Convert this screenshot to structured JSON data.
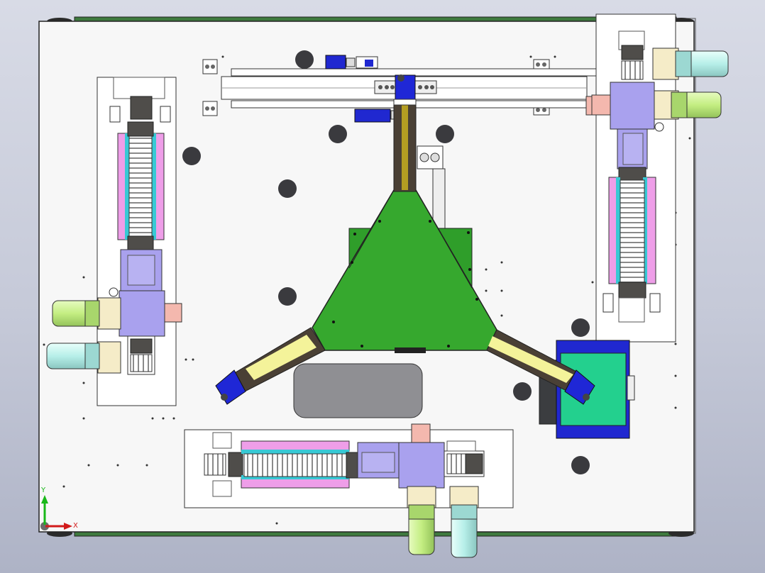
{
  "axis_triad": {
    "x_label": "X",
    "y_label": "Y"
  },
  "colors": {
    "background_top": "#d8dbe6",
    "background_bottom": "#aeb3c6",
    "base_plate": "#f7f7f7",
    "frame_edge": "#3e7a3e",
    "rail": "#9a9ab8",
    "carriage": "#a9a1ee",
    "linear_guide": "#ee9ee8",
    "guide_inner": "#37c9d5",
    "motor_green": "#c8f08a",
    "motor_cyan": "#b9f0ea",
    "delta_plate": "#2f9e2a",
    "arm_dark": "#4a4035",
    "arm_light": "#f4f39a",
    "joint_blue": "#1f27d6",
    "table_green": "#23d08e",
    "hole_dark": "#3a3a3e",
    "window_gray": "#8f8f93"
  }
}
